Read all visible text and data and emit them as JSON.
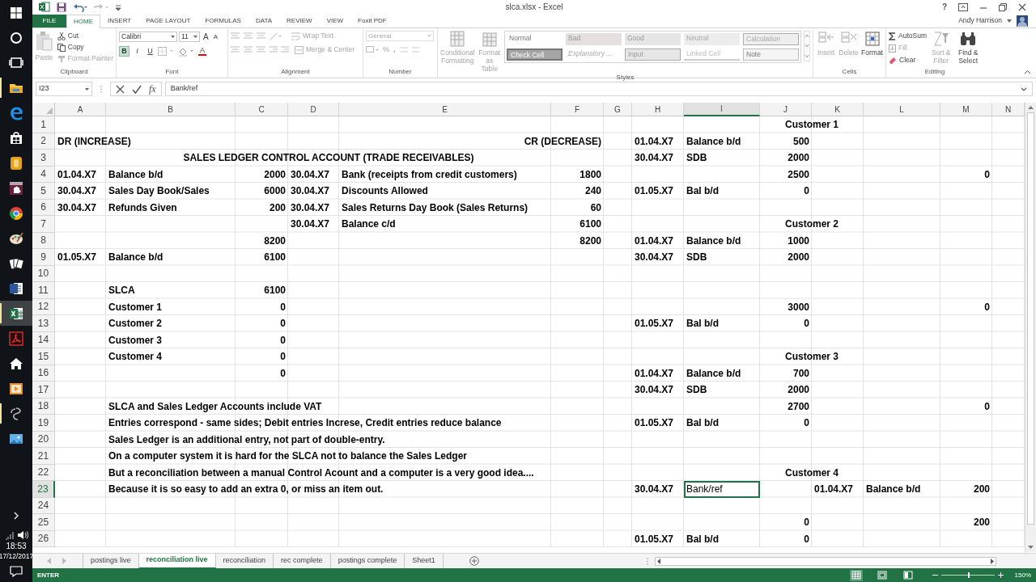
{
  "taskbar": {
    "apps": [
      {
        "kind": "windows",
        "running": false,
        "selected": false
      },
      {
        "kind": "cortana",
        "running": false,
        "selected": false
      },
      {
        "kind": "taskview",
        "running": false,
        "selected": false
      },
      {
        "kind": "explorer",
        "running": true,
        "selected": false
      },
      {
        "kind": "edge",
        "running": false,
        "selected": false
      },
      {
        "kind": "store",
        "running": false,
        "selected": false
      },
      {
        "kind": "tile_orange",
        "running": false,
        "selected": false
      },
      {
        "kind": "tile_puzzle",
        "running": false,
        "selected": false
      },
      {
        "kind": "chrome",
        "running": false,
        "selected": false
      },
      {
        "kind": "paint",
        "running": false,
        "selected": false
      },
      {
        "kind": "cards",
        "running": false,
        "selected": false
      },
      {
        "kind": "word",
        "running": false,
        "selected": false
      },
      {
        "kind": "excel",
        "running": true,
        "selected": true
      },
      {
        "kind": "acrobat",
        "running": false,
        "selected": false
      },
      {
        "kind": "home",
        "running": false,
        "selected": false
      },
      {
        "kind": "media",
        "running": false,
        "selected": false
      },
      {
        "kind": "swirl",
        "running": true,
        "selected": false
      },
      {
        "kind": "photo",
        "running": false,
        "selected": false
      }
    ],
    "time": "18:53",
    "date": "17/12/2017"
  },
  "window": {
    "title": "slca.xlsx - Excel",
    "help": "?",
    "user": "Andy Harrison"
  },
  "tabs": [
    {
      "label": "FILE",
      "kind": "file",
      "selected": false
    },
    {
      "label": "HOME",
      "kind": "tab",
      "selected": true
    },
    {
      "label": "INSERT",
      "kind": "tab",
      "selected": false
    },
    {
      "label": "PAGE LAYOUT",
      "kind": "tab",
      "selected": false
    },
    {
      "label": "FORMULAS",
      "kind": "tab",
      "selected": false
    },
    {
      "label": "DATA",
      "kind": "tab",
      "selected": false
    },
    {
      "label": "REVIEW",
      "kind": "tab",
      "selected": false
    },
    {
      "label": "VIEW",
      "kind": "tab",
      "selected": false
    },
    {
      "label": "Foxit PDF",
      "kind": "tab",
      "selected": false
    }
  ],
  "ribbon": {
    "clipboard": {
      "label": "Clipboard",
      "commands": [
        {
          "label": "Paste",
          "disabled": true
        },
        {
          "label": "Cut",
          "disabled": false
        },
        {
          "label": "Copy",
          "disabled": false
        },
        {
          "label": "Format Painter",
          "disabled": true
        }
      ]
    },
    "font": {
      "label": "Font",
      "font_name": "Calibri",
      "font_size": "11",
      "grow": "A",
      "shrink": "A",
      "buttons": [
        {
          "label": "B",
          "selected": true
        },
        {
          "label": "I",
          "selected": false
        },
        {
          "label": "U",
          "selected": false
        }
      ],
      "font_color": "A"
    },
    "alignment": {
      "label": "Alignment",
      "commands": [
        {
          "label": "Wrap Text",
          "disabled": true
        },
        {
          "label": "Merge & Center",
          "disabled": true
        }
      ]
    },
    "number": {
      "label": "Number",
      "format": "General",
      "percent": "%",
      "comma": ","
    },
    "styles": {
      "label": "Styles",
      "commands": [
        {
          "label": "Conditional Formatting",
          "disabled": true
        },
        {
          "label": "Format as Table",
          "disabled": true
        }
      ],
      "gallery": [
        {
          "label": "Normal",
          "kind": "normal"
        },
        {
          "label": "Bad",
          "kind": "bad"
        },
        {
          "label": "Good",
          "kind": "good"
        },
        {
          "label": "Neutral",
          "kind": "neutral"
        },
        {
          "label": "Calculation",
          "kind": "calculation"
        },
        {
          "label": "Check Cell",
          "kind": "check"
        },
        {
          "label": "Explanatory ...",
          "kind": "explanatory"
        },
        {
          "label": "Input",
          "kind": "input"
        },
        {
          "label": "Linked Cell",
          "kind": "linked"
        },
        {
          "label": "Note",
          "kind": "note"
        }
      ]
    },
    "cells": {
      "label": "Cells",
      "commands": [
        {
          "label": "Insert",
          "disabled": true
        },
        {
          "label": "Delete",
          "disabled": true
        },
        {
          "label": "Format",
          "disabled": false
        }
      ]
    },
    "editing": {
      "label": "Editing",
      "commands": [
        {
          "label": "AutoSum",
          "disabled": false
        },
        {
          "label": "Fill",
          "disabled": true
        },
        {
          "label": "Clear",
          "disabled": false
        },
        {
          "label": "Sort & Filter",
          "disabled": true
        },
        {
          "label": "Find & Select",
          "disabled": false
        }
      ]
    }
  },
  "formula_bar": {
    "name_box": "I23",
    "fx": "fx",
    "content": "Bank/ref"
  },
  "sheet": {
    "columns": [
      {
        "label": "A",
        "selected": false
      },
      {
        "label": "B",
        "selected": false
      },
      {
        "label": "C",
        "selected": false
      },
      {
        "label": "D",
        "selected": false
      },
      {
        "label": "E",
        "selected": false
      },
      {
        "label": "F",
        "selected": false
      },
      {
        "label": "G",
        "selected": false
      },
      {
        "label": "H",
        "selected": false
      },
      {
        "label": "I",
        "selected": true
      },
      {
        "label": "J",
        "selected": false
      },
      {
        "label": "K",
        "selected": false
      },
      {
        "label": "L",
        "selected": false
      },
      {
        "label": "M",
        "selected": false
      },
      {
        "label": "N",
        "selected": false
      }
    ],
    "rows": [
      {
        "label": "1",
        "selected": false,
        "cells": [
          "",
          "",
          "",
          "",
          "",
          "",
          "",
          "",
          "",
          {
            "text": "Customer 1",
            "kind": "title"
          }
        ]
      },
      {
        "label": "2",
        "selected": false,
        "cells": [
          {
            "text": "DR (INCREASE)",
            "kind": "text"
          },
          "",
          "",
          "",
          "",
          {
            "text": "CR (DECREASE)",
            "kind": "right"
          },
          "",
          {
            "text": "01.04.X7",
            "kind": "text"
          },
          {
            "text": "Balance b/d",
            "kind": "text"
          },
          {
            "text": "500",
            "kind": "number"
          }
        ]
      },
      {
        "label": "3",
        "selected": false,
        "cells": [
          "",
          "",
          {
            "text": "SALES LEDGER CONTROL ACCOUNT (TRADE RECEIVABLES)",
            "kind": "title"
          },
          "",
          "",
          "",
          "",
          {
            "text": "30.04.X7",
            "kind": "text"
          },
          {
            "text": "SDB",
            "kind": "text"
          },
          {
            "text": "2000",
            "kind": "number"
          }
        ]
      },
      {
        "label": "4",
        "selected": false,
        "cells": [
          {
            "text": "01.04.X7",
            "kind": "text"
          },
          {
            "text": "Balance b/d",
            "kind": "text"
          },
          {
            "text": "2000",
            "kind": "number"
          },
          {
            "text": "30.04.X7",
            "kind": "text"
          },
          {
            "text": "Bank (receipts from credit customers)",
            "kind": "text"
          },
          {
            "text": "1800",
            "kind": "number"
          },
          "",
          "",
          "",
          {
            "text": "2500",
            "kind": "number"
          },
          "",
          "",
          {
            "text": "0",
            "kind": "number"
          }
        ]
      },
      {
        "label": "5",
        "selected": false,
        "cells": [
          {
            "text": "30.04.X7",
            "kind": "text"
          },
          {
            "text": "Sales Day Book/Sales",
            "kind": "text"
          },
          {
            "text": "6000",
            "kind": "number"
          },
          {
            "text": "30.04.X7",
            "kind": "text"
          },
          {
            "text": "Discounts Allowed",
            "kind": "text"
          },
          {
            "text": "240",
            "kind": "number"
          },
          "",
          {
            "text": "01.05.X7",
            "kind": "text"
          },
          {
            "text": "Bal b/d",
            "kind": "text"
          },
          {
            "text": "0",
            "kind": "number"
          }
        ]
      },
      {
        "label": "6",
        "selected": false,
        "cells": [
          {
            "text": "30.04.X7",
            "kind": "text"
          },
          {
            "text": "Refunds Given",
            "kind": "text"
          },
          {
            "text": "200",
            "kind": "number"
          },
          {
            "text": "30.04.X7",
            "kind": "text"
          },
          {
            "text": "Sales Returns Day Book (Sales Returns)",
            "kind": "text"
          },
          {
            "text": "60",
            "kind": "number"
          }
        ]
      },
      {
        "label": "7",
        "selected": false,
        "cells": [
          "",
          "",
          "",
          {
            "text": "30.04.X7",
            "kind": "text"
          },
          {
            "text": "Balance c/d",
            "kind": "text"
          },
          {
            "text": "6100",
            "kind": "number"
          },
          "",
          "",
          "",
          {
            "text": "Customer 2",
            "kind": "title"
          }
        ]
      },
      {
        "label": "8",
        "selected": false,
        "cells": [
          "",
          "",
          {
            "text": "8200",
            "kind": "number"
          },
          "",
          "",
          {
            "text": "8200",
            "kind": "number"
          },
          "",
          {
            "text": "01.04.X7",
            "kind": "text"
          },
          {
            "text": "Balance b/d",
            "kind": "text"
          },
          {
            "text": "1000",
            "kind": "number"
          }
        ]
      },
      {
        "label": "9",
        "selected": false,
        "cells": [
          {
            "text": "01.05.X7",
            "kind": "text"
          },
          {
            "text": "Balance b/d",
            "kind": "text"
          },
          {
            "text": "6100",
            "kind": "number"
          },
          "",
          "",
          "",
          "",
          {
            "text": "30.04.X7",
            "kind": "text"
          },
          {
            "text": "SDB",
            "kind": "text"
          },
          {
            "text": "2000",
            "kind": "number"
          }
        ]
      },
      {
        "label": "10",
        "selected": false
      },
      {
        "label": "11",
        "selected": false,
        "cells": [
          "",
          {
            "text": "SLCA",
            "kind": "text"
          },
          {
            "text": "6100",
            "kind": "number"
          }
        ]
      },
      {
        "label": "12",
        "selected": false,
        "cells": [
          "",
          {
            "text": "Customer 1",
            "kind": "text"
          },
          {
            "text": "0",
            "kind": "number"
          },
          "",
          "",
          "",
          "",
          "",
          "",
          {
            "text": "3000",
            "kind": "number"
          },
          "",
          "",
          {
            "text": "0",
            "kind": "number"
          }
        ]
      },
      {
        "label": "13",
        "selected": false,
        "cells": [
          "",
          {
            "text": "Customer 2",
            "kind": "text"
          },
          {
            "text": "0",
            "kind": "number"
          },
          "",
          "",
          "",
          "",
          {
            "text": "01.05.X7",
            "kind": "text"
          },
          {
            "text": "Bal b/d",
            "kind": "text"
          },
          {
            "text": "0",
            "kind": "number"
          }
        ]
      },
      {
        "label": "14",
        "selected": false,
        "cells": [
          "",
          {
            "text": "Customer 3",
            "kind": "text"
          },
          {
            "text": "0",
            "kind": "number"
          }
        ]
      },
      {
        "label": "15",
        "selected": false,
        "cells": [
          "",
          {
            "text": "Customer 4",
            "kind": "text"
          },
          {
            "text": "0",
            "kind": "number"
          },
          "",
          "",
          "",
          "",
          "",
          "",
          {
            "text": "Customer 3",
            "kind": "title"
          }
        ]
      },
      {
        "label": "16",
        "selected": false,
        "cells": [
          "",
          "",
          {
            "text": "0",
            "kind": "number"
          },
          "",
          "",
          "",
          "",
          {
            "text": "01.04.X7",
            "kind": "text"
          },
          {
            "text": "Balance b/d",
            "kind": "text"
          },
          {
            "text": "700",
            "kind": "number"
          }
        ]
      },
      {
        "label": "17",
        "selected": false,
        "cells": [
          "",
          "",
          "",
          "",
          "",
          "",
          "",
          {
            "text": "30.04.X7",
            "kind": "text"
          },
          {
            "text": "SDB",
            "kind": "text"
          },
          {
            "text": "2000",
            "kind": "number"
          }
        ]
      },
      {
        "label": "18",
        "selected": false,
        "cells": [
          "",
          {
            "text": "SLCA and Sales Ledger Accounts include VAT",
            "kind": "text"
          },
          "",
          "",
          "",
          "",
          "",
          "",
          "",
          {
            "text": "2700",
            "kind": "number"
          },
          "",
          "",
          {
            "text": "0",
            "kind": "number"
          }
        ]
      },
      {
        "label": "19",
        "selected": false,
        "cells": [
          "",
          {
            "text": "Entries correspond - same sides; Debit entries Increse, Credit entries reduce balance",
            "kind": "text"
          },
          "",
          "",
          "",
          "",
          "",
          {
            "text": "01.05.X7",
            "kind": "text"
          },
          {
            "text": "Bal b/d",
            "kind": "text"
          },
          {
            "text": "0",
            "kind": "number"
          }
        ]
      },
      {
        "label": "20",
        "selected": false,
        "cells": [
          "",
          {
            "text": "Sales Ledger is an additional entry, not part of double-entry.",
            "kind": "text"
          }
        ]
      },
      {
        "label": "21",
        "selected": false,
        "cells": [
          "",
          {
            "text": "On a computer system it is hard for the SLCA not to balance the Sales Ledger",
            "kind": "text"
          }
        ]
      },
      {
        "label": "22",
        "selected": false,
        "cells": [
          "",
          {
            "text": "But a reconciliation between a manual Control Acount and a computer is a very good idea....",
            "kind": "text"
          },
          "",
          "",
          "",
          "",
          "",
          "",
          "",
          {
            "text": "Customer 4",
            "kind": "title"
          }
        ]
      },
      {
        "label": "23",
        "selected": true,
        "cells": [
          "",
          {
            "text": "Because it is so easy to add an extra 0, or miss an item out.",
            "kind": "text"
          },
          "",
          "",
          "",
          "",
          "",
          {
            "text": "30.04.X7",
            "kind": "text"
          },
          {
            "text": "Bank/ref",
            "kind": "text"
          },
          "",
          {
            "text": "01.04.X7",
            "kind": "text"
          },
          {
            "text": "Balance b/d",
            "kind": "text"
          },
          {
            "text": "200",
            "kind": "number"
          }
        ]
      },
      {
        "label": "24",
        "selected": false
      },
      {
        "label": "25",
        "selected": false,
        "cells": [
          "",
          "",
          "",
          "",
          "",
          "",
          "",
          "",
          "",
          {
            "text": "0",
            "kind": "number"
          },
          "",
          "",
          {
            "text": "200",
            "kind": "number"
          }
        ]
      },
      {
        "label": "26",
        "selected": false,
        "cells": [
          "",
          "",
          "",
          "",
          "",
          "",
          "",
          {
            "text": "01.05.X7",
            "kind": "text"
          },
          {
            "text": "Bal b/d",
            "kind": "text"
          },
          {
            "text": "0",
            "kind": "number"
          }
        ]
      }
    ]
  },
  "sheet_tabs": [
    {
      "label": "postings live",
      "selected": false
    },
    {
      "label": "reconciliation live",
      "selected": true
    },
    {
      "label": "reconciliation",
      "selected": false
    },
    {
      "label": "rec complete",
      "selected": false
    },
    {
      "label": "postings complete",
      "selected": false
    },
    {
      "label": "Sheet1",
      "selected": false
    }
  ],
  "status_bar": {
    "mode": "ENTER",
    "views": [
      {
        "kind": "normal",
        "selected": true
      },
      {
        "kind": "page_layout",
        "selected": false
      },
      {
        "kind": "page_break",
        "selected": false
      }
    ],
    "zoom": {
      "level": 0.5,
      "reading": "150%"
    }
  }
}
